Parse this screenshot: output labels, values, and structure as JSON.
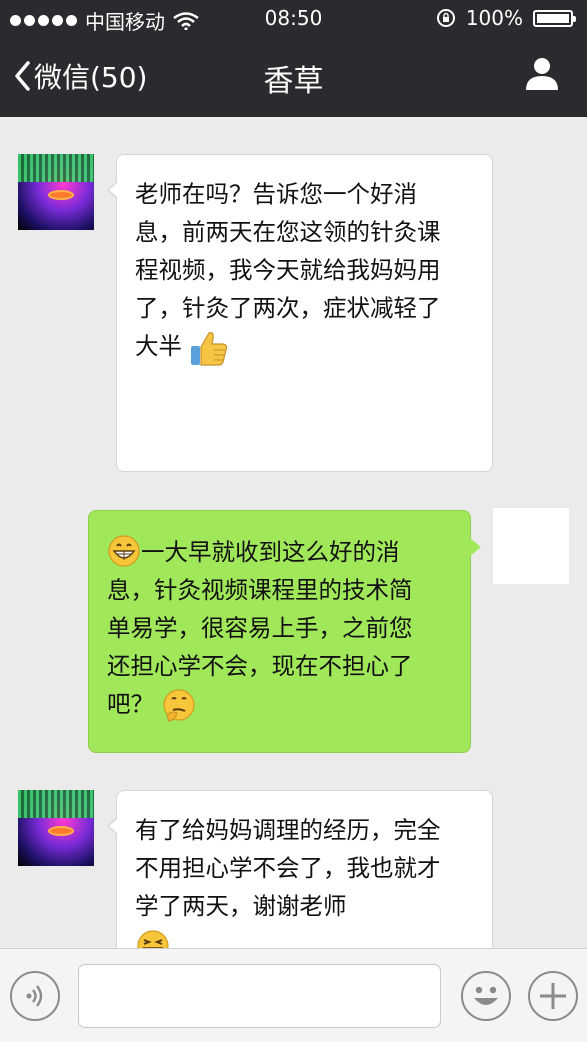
{
  "status_bar": {
    "carrier": "中国移动",
    "time": "08:50",
    "battery": "100%"
  },
  "nav": {
    "back_label": "微信(50)",
    "title": "香草"
  },
  "messages": [
    {
      "side": "in",
      "text": "老师在吗？告诉您一个好消\n息，前两天在您这领的针灸课\n程视频，我今天就给我妈妈用\n了，针灸了两次，症状减轻了\n大半",
      "emoji": "thumbs-up-icon"
    },
    {
      "side": "out",
      "leading_emoji": "grinning-face-icon",
      "text": "一大早就收到这么好的消\n息，针灸视频课程里的技术简\n单易学，很容易上手，之前您\n还担心学不会，现在不担心了\n吧？",
      "emoji": "thinking-face-icon"
    },
    {
      "side": "in",
      "text": "有了给妈妈调理的经历，完全\n不用担心学不会了，我也就才\n学了两天，谢谢老师",
      "emoji": "laughing-face-icon"
    }
  ],
  "input_bar": {
    "icons": [
      "voice-icon",
      "emoji-icon",
      "plus-icon"
    ]
  },
  "colors": {
    "nav_bg": "#2b2b2f",
    "chat_bg": "#ebebeb",
    "out_bubble": "#a0e75a",
    "in_bubble": "#ffffff"
  }
}
